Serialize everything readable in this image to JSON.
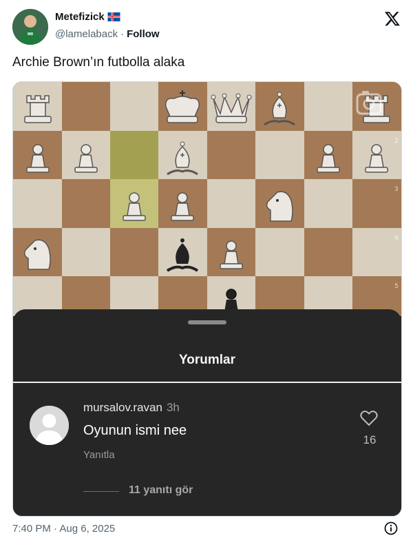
{
  "tweet": {
    "display_name": "Metefizick",
    "flag_icon": "iceland-flag-icon",
    "handle": "@lamelaback",
    "separator": "·",
    "follow_label": "Follow",
    "text": "Archie Brown’ın futbolla alaka",
    "timestamp": "7:40 PM · Aug 6, 2025"
  },
  "comments_sheet": {
    "title": "Yorumlar",
    "comment": {
      "username": "mursalov.ravan",
      "time": "3h",
      "text": "Oyunun ismi nee",
      "reply_label": "Yanıtla",
      "likes": "16"
    },
    "view_replies": "11 yanıtı gör"
  },
  "board": {
    "rank_numbers": [
      "2",
      "3",
      "4",
      "5"
    ],
    "pieces": [
      "white-rook",
      "white-king",
      "white-queen",
      "white-bishop",
      "white-rook",
      "white-pawn",
      "white-pawn",
      "white-bishop",
      "white-pawn",
      "white-pawn",
      "white-pawn",
      "white-pawn",
      "white-knight",
      "white-knight",
      "black-bishop",
      "white-pawn",
      "black-pawn"
    ]
  },
  "colors": {
    "light_square": "#d8cfbe",
    "dark_square": "#a37a55",
    "highlight_square": "#a3a052",
    "sheet_background": "#262626"
  }
}
